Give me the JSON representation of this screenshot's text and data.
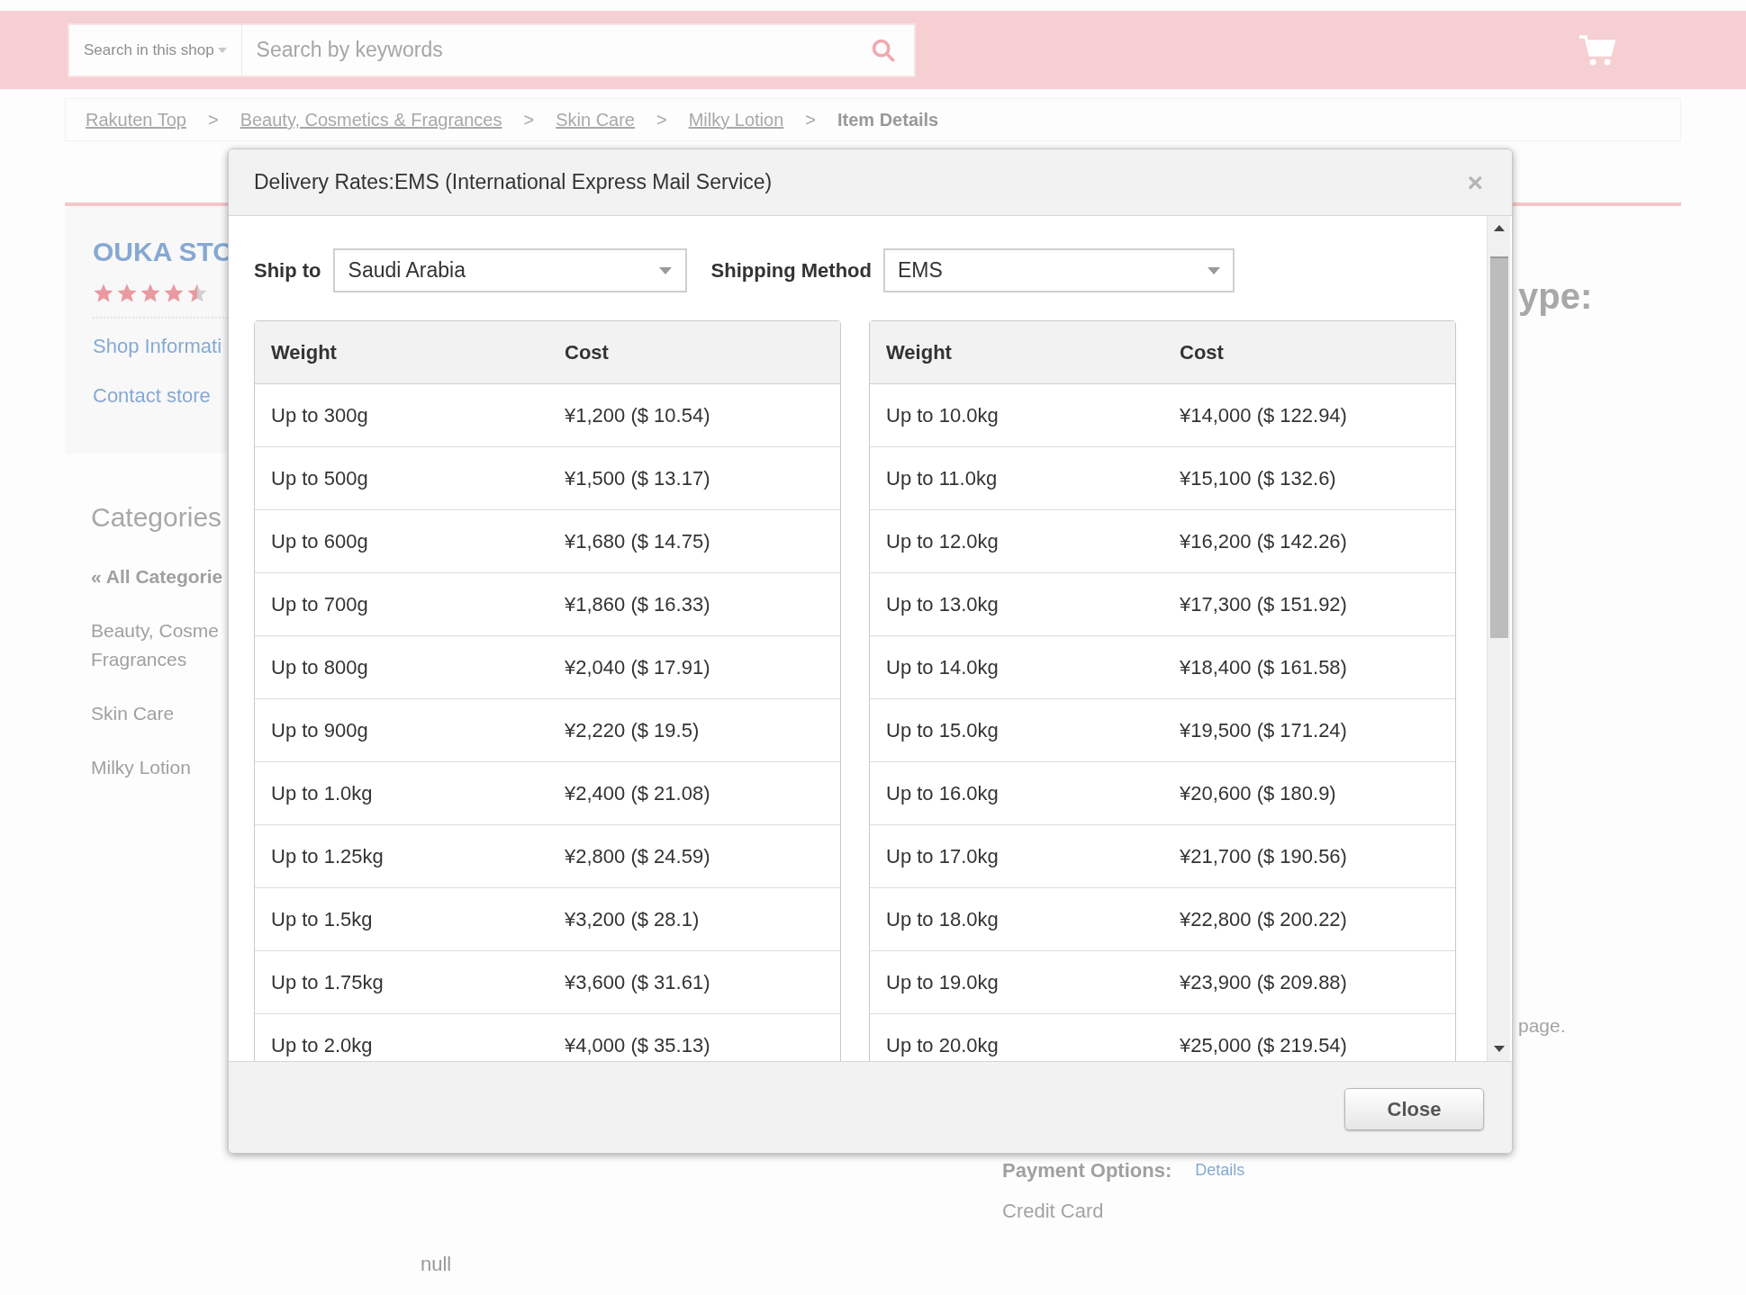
{
  "header": {
    "search_scope": "Search in this shop",
    "search_placeholder": "Search by keywords"
  },
  "breadcrumb": [
    {
      "label": "Rakuten Top",
      "current": false
    },
    {
      "label": "Beauty, Cosmetics & Fragrances",
      "current": false
    },
    {
      "label": "Skin Care",
      "current": false
    },
    {
      "label": "Milky Lotion",
      "current": false
    },
    {
      "label": "Item Details",
      "current": true
    }
  ],
  "breadcrumb_separator": ">",
  "shop": {
    "name": "OUKA STO",
    "stars": 4.5,
    "links": [
      "Shop Informati",
      "Contact store"
    ]
  },
  "categories": {
    "title": "Categories",
    "all": "« All Categorie",
    "items": [
      {
        "lines": [
          "Beauty, Cosme",
          "Fragrances"
        ]
      },
      {
        "lines": [
          "Skin Care"
        ]
      },
      {
        "lines": [
          "Milky Lotion"
        ]
      }
    ]
  },
  "right_fragments": {
    "heading": "ype:",
    "note": "page."
  },
  "payment": {
    "label": "Payment Options:",
    "link": "Details",
    "value": "Credit Card"
  },
  "footer_text": "null",
  "dialog": {
    "title": "Delivery Rates:EMS (International Express Mail Service)",
    "close_icon": "×",
    "ship_to": {
      "label": "Ship to",
      "value": "Saudi Arabia"
    },
    "method": {
      "label": "Shipping Method",
      "value": "EMS"
    },
    "tables": [
      {
        "columns": [
          "Weight",
          "Cost"
        ],
        "rows": [
          [
            "Up to 300g",
            "¥1,200 ($ 10.54)"
          ],
          [
            "Up to 500g",
            "¥1,500 ($ 13.17)"
          ],
          [
            "Up to 600g",
            "¥1,680 ($ 14.75)"
          ],
          [
            "Up to 700g",
            "¥1,860 ($ 16.33)"
          ],
          [
            "Up to 800g",
            "¥2,040 ($ 17.91)"
          ],
          [
            "Up to 900g",
            "¥2,220 ($ 19.5)"
          ],
          [
            "Up to 1.0kg",
            "¥2,400 ($ 21.08)"
          ],
          [
            "Up to 1.25kg",
            "¥2,800 ($ 24.59)"
          ],
          [
            "Up to 1.5kg",
            "¥3,200 ($ 28.1)"
          ],
          [
            "Up to 1.75kg",
            "¥3,600 ($ 31.61)"
          ],
          [
            "Up to 2.0kg",
            "¥4,000 ($ 35.13)"
          ]
        ]
      },
      {
        "columns": [
          "Weight",
          "Cost"
        ],
        "rows": [
          [
            "Up to 10.0kg",
            "¥14,000 ($ 122.94)"
          ],
          [
            "Up to 11.0kg",
            "¥15,100 ($ 132.6)"
          ],
          [
            "Up to 12.0kg",
            "¥16,200 ($ 142.26)"
          ],
          [
            "Up to 13.0kg",
            "¥17,300 ($ 151.92)"
          ],
          [
            "Up to 14.0kg",
            "¥18,400 ($ 161.58)"
          ],
          [
            "Up to 15.0kg",
            "¥19,500 ($ 171.24)"
          ],
          [
            "Up to 16.0kg",
            "¥20,600 ($ 180.9)"
          ],
          [
            "Up to 17.0kg",
            "¥21,700 ($ 190.56)"
          ],
          [
            "Up to 18.0kg",
            "¥22,800 ($ 200.22)"
          ],
          [
            "Up to 19.0kg",
            "¥23,900 ($ 209.88)"
          ],
          [
            "Up to 20.0kg",
            "¥25,000 ($ 219.54)"
          ]
        ]
      }
    ],
    "button": "Close"
  }
}
